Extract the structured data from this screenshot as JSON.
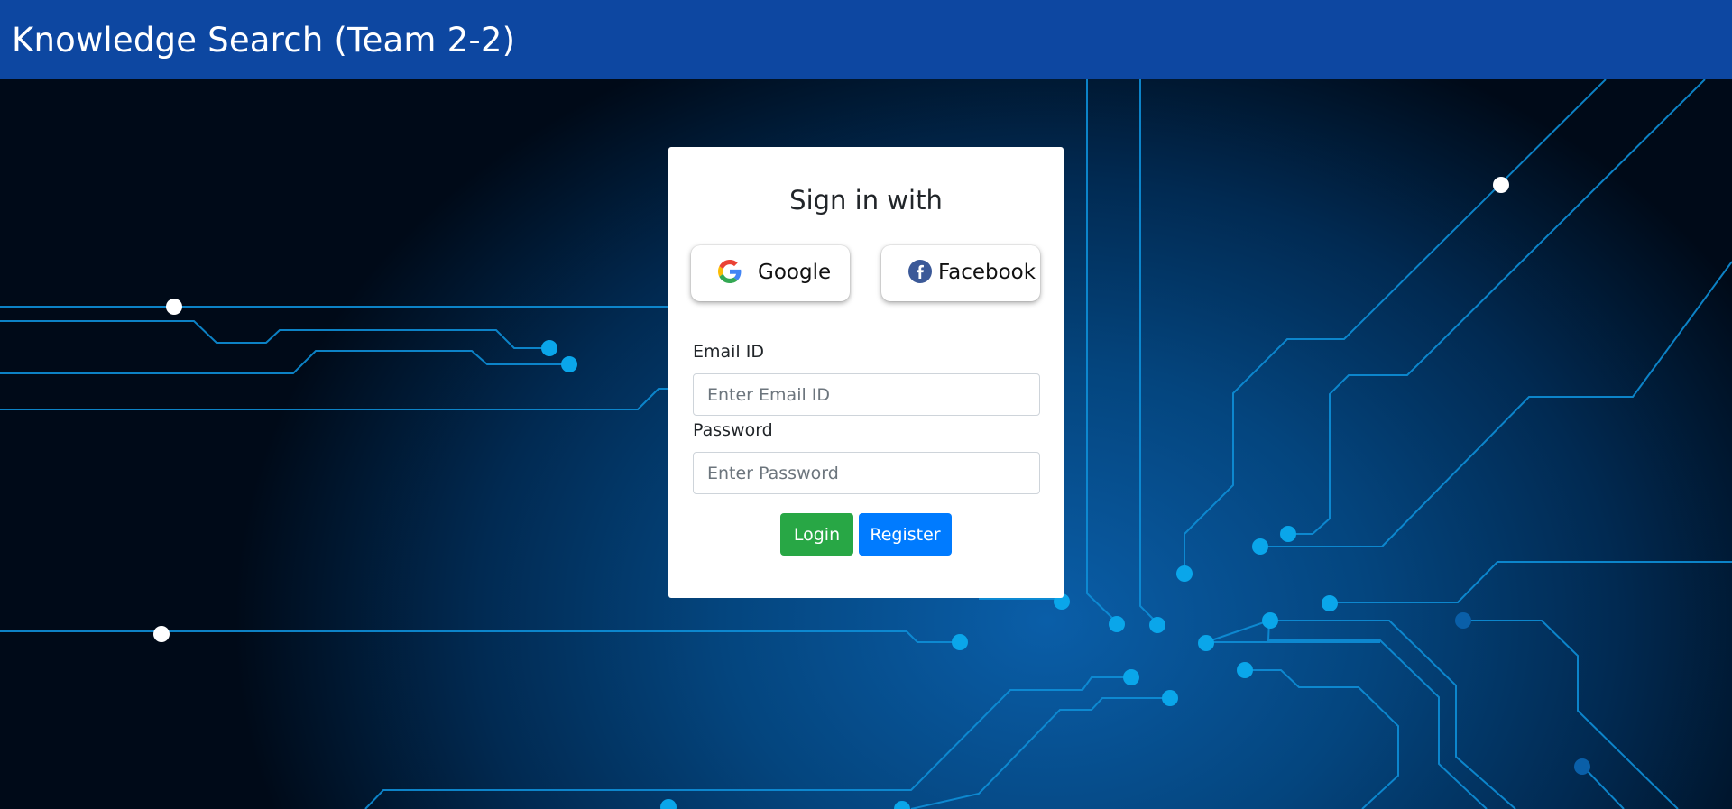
{
  "header": {
    "title": "Knowledge Search (Team 2-2)"
  },
  "signin": {
    "title": "Sign in with",
    "google_label": "Google",
    "facebook_label": "Facebook",
    "google_icon": "google-g-icon",
    "facebook_icon": "facebook-f-icon",
    "email_label": "Email ID",
    "email_placeholder": "Enter Email ID",
    "email_value": "",
    "password_label": "Password",
    "password_placeholder": "Enter Password",
    "password_value": "",
    "login_label": "Login",
    "register_label": "Register"
  },
  "colors": {
    "header_bg": "#0d47a1",
    "login_bg": "#28a745",
    "register_bg": "#007bff",
    "circuit_line": "#0e8fd8",
    "circuit_node": "#0aa6ea"
  }
}
